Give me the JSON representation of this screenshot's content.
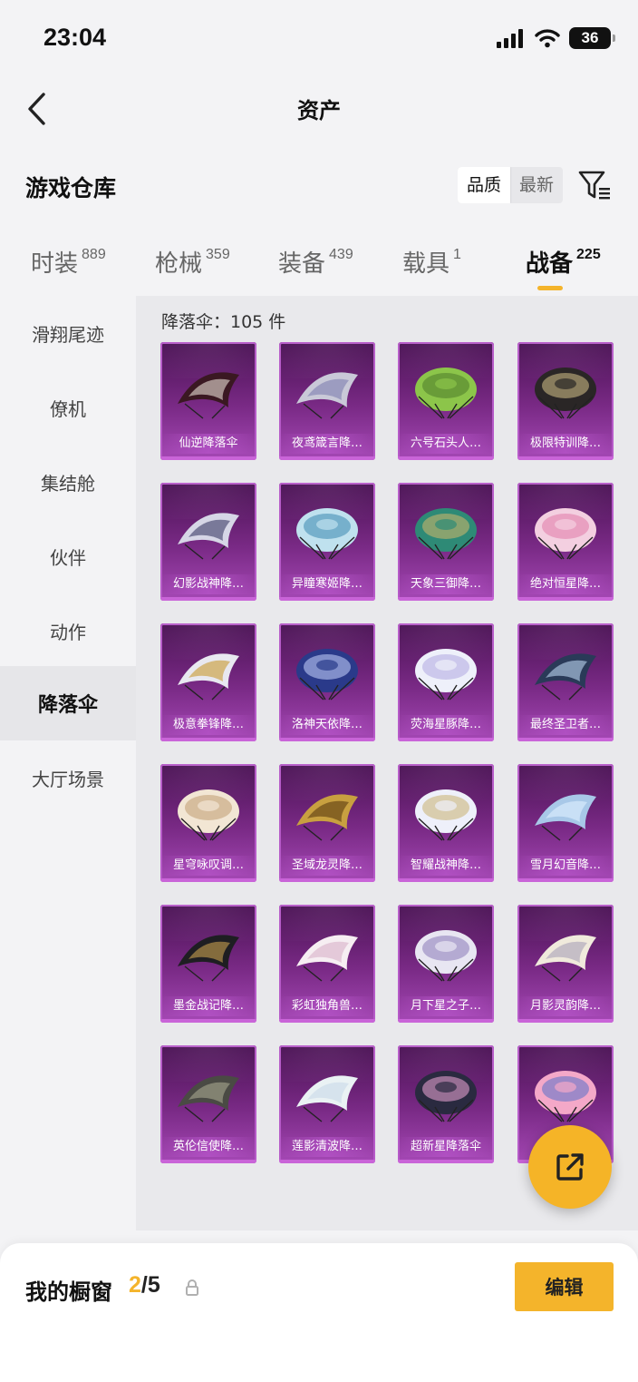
{
  "status_bar": {
    "time": "23:04",
    "battery": "36"
  },
  "nav": {
    "title": "资产"
  },
  "section": {
    "title": "游戏仓库",
    "sort_options": [
      "品质",
      "最新"
    ]
  },
  "tabs": [
    {
      "label": "时装",
      "count": "889",
      "active": false
    },
    {
      "label": "枪械",
      "count": "359",
      "active": false
    },
    {
      "label": "装备",
      "count": "439",
      "active": false
    },
    {
      "label": "载具",
      "count": "1",
      "active": false
    },
    {
      "label": "战备",
      "count": "225",
      "active": true
    }
  ],
  "sidebar": {
    "items": [
      {
        "label": "滑翔尾迹",
        "active": false
      },
      {
        "label": "僚机",
        "active": false
      },
      {
        "label": "集结舱",
        "active": false
      },
      {
        "label": "伙伴",
        "active": false
      },
      {
        "label": "动作",
        "active": false
      },
      {
        "label": "降落伞",
        "active": true
      },
      {
        "label": "大厅场景",
        "active": false
      }
    ]
  },
  "content": {
    "count_label": "降落伞：105 件",
    "items": [
      {
        "name": "仙逆降落伞",
        "canopy": "#3a1822",
        "accent": "#e8e0d6",
        "shape": "wing"
      },
      {
        "name": "夜鸢箴言降…",
        "canopy": "#c9c9d8",
        "accent": "#7e7fb0",
        "shape": "wing"
      },
      {
        "name": "六号石头人…",
        "canopy": "#8cc54a",
        "accent": "#4c7a2a",
        "shape": "dome"
      },
      {
        "name": "极限特训降…",
        "canopy": "#2a2626",
        "accent": "#d6c28a",
        "shape": "dome"
      },
      {
        "name": "幻影战神降…",
        "canopy": "#d6d6e6",
        "accent": "#3a3a66",
        "shape": "wing"
      },
      {
        "name": "异瞳寒姬降…",
        "canopy": "#bfe1ee",
        "accent": "#3a88b0",
        "shape": "dome"
      },
      {
        "name": "天象三御降…",
        "canopy": "#2e8a76",
        "accent": "#d6b86a",
        "shape": "dome"
      },
      {
        "name": "绝对恒星降…",
        "canopy": "#f3cfe0",
        "accent": "#e07aa8",
        "shape": "dome"
      },
      {
        "name": "极意拳锋降…",
        "canopy": "#e8e8f0",
        "accent": "#c89a30",
        "shape": "wing"
      },
      {
        "name": "洛神天依降…",
        "canopy": "#2a3a8a",
        "accent": "#c8d6ff",
        "shape": "dome"
      },
      {
        "name": "荧海星豚降…",
        "canopy": "#eef0fa",
        "accent": "#b0a8e0",
        "shape": "dome"
      },
      {
        "name": "最终圣卫者…",
        "canopy": "#2a3a58",
        "accent": "#bcd6f0",
        "shape": "wing"
      },
      {
        "name": "星穹咏叹调…",
        "canopy": "#f2e6d4",
        "accent": "#c09a70",
        "shape": "dome"
      },
      {
        "name": "圣域龙灵降…",
        "canopy": "#c8a040",
        "accent": "#5a3a10",
        "shape": "wing"
      },
      {
        "name": "智耀战神降…",
        "canopy": "#eef0fa",
        "accent": "#c8b070",
        "shape": "dome"
      },
      {
        "name": "雪月幻音降…",
        "canopy": "#a8c8e8",
        "accent": "#e0f0ff",
        "shape": "wing"
      },
      {
        "name": "墨金战记降…",
        "canopy": "#1e1e22",
        "accent": "#c8a050",
        "shape": "wing"
      },
      {
        "name": "彩虹独角兽…",
        "canopy": "#f6eef2",
        "accent": "#d8b0c8",
        "shape": "wing"
      },
      {
        "name": "月下星之子…",
        "canopy": "#e8e6f2",
        "accent": "#8878b8",
        "shape": "dome"
      },
      {
        "name": "月影灵韵降…",
        "canopy": "#f0eadc",
        "accent": "#a8a0b8",
        "shape": "wing"
      },
      {
        "name": "英伦信使降…",
        "canopy": "#4a4a44",
        "accent": "#a8a890",
        "shape": "wing"
      },
      {
        "name": "莲影清波降…",
        "canopy": "#eaf2f4",
        "accent": "#c8d8e8",
        "shape": "wing"
      },
      {
        "name": "超新星降落伞",
        "canopy": "#2a2a40",
        "accent": "#f0a8d8",
        "shape": "dome"
      },
      {
        "name": "",
        "canopy": "#f4a8c8",
        "accent": "#5870c8",
        "shape": "dome"
      }
    ]
  },
  "bottom": {
    "label": "我的橱窗",
    "current": "2",
    "separator": "/",
    "total": "5",
    "edit_label": "编辑"
  },
  "colors": {
    "accent": "#f4b42b",
    "card_purple": "#7a2a86"
  }
}
